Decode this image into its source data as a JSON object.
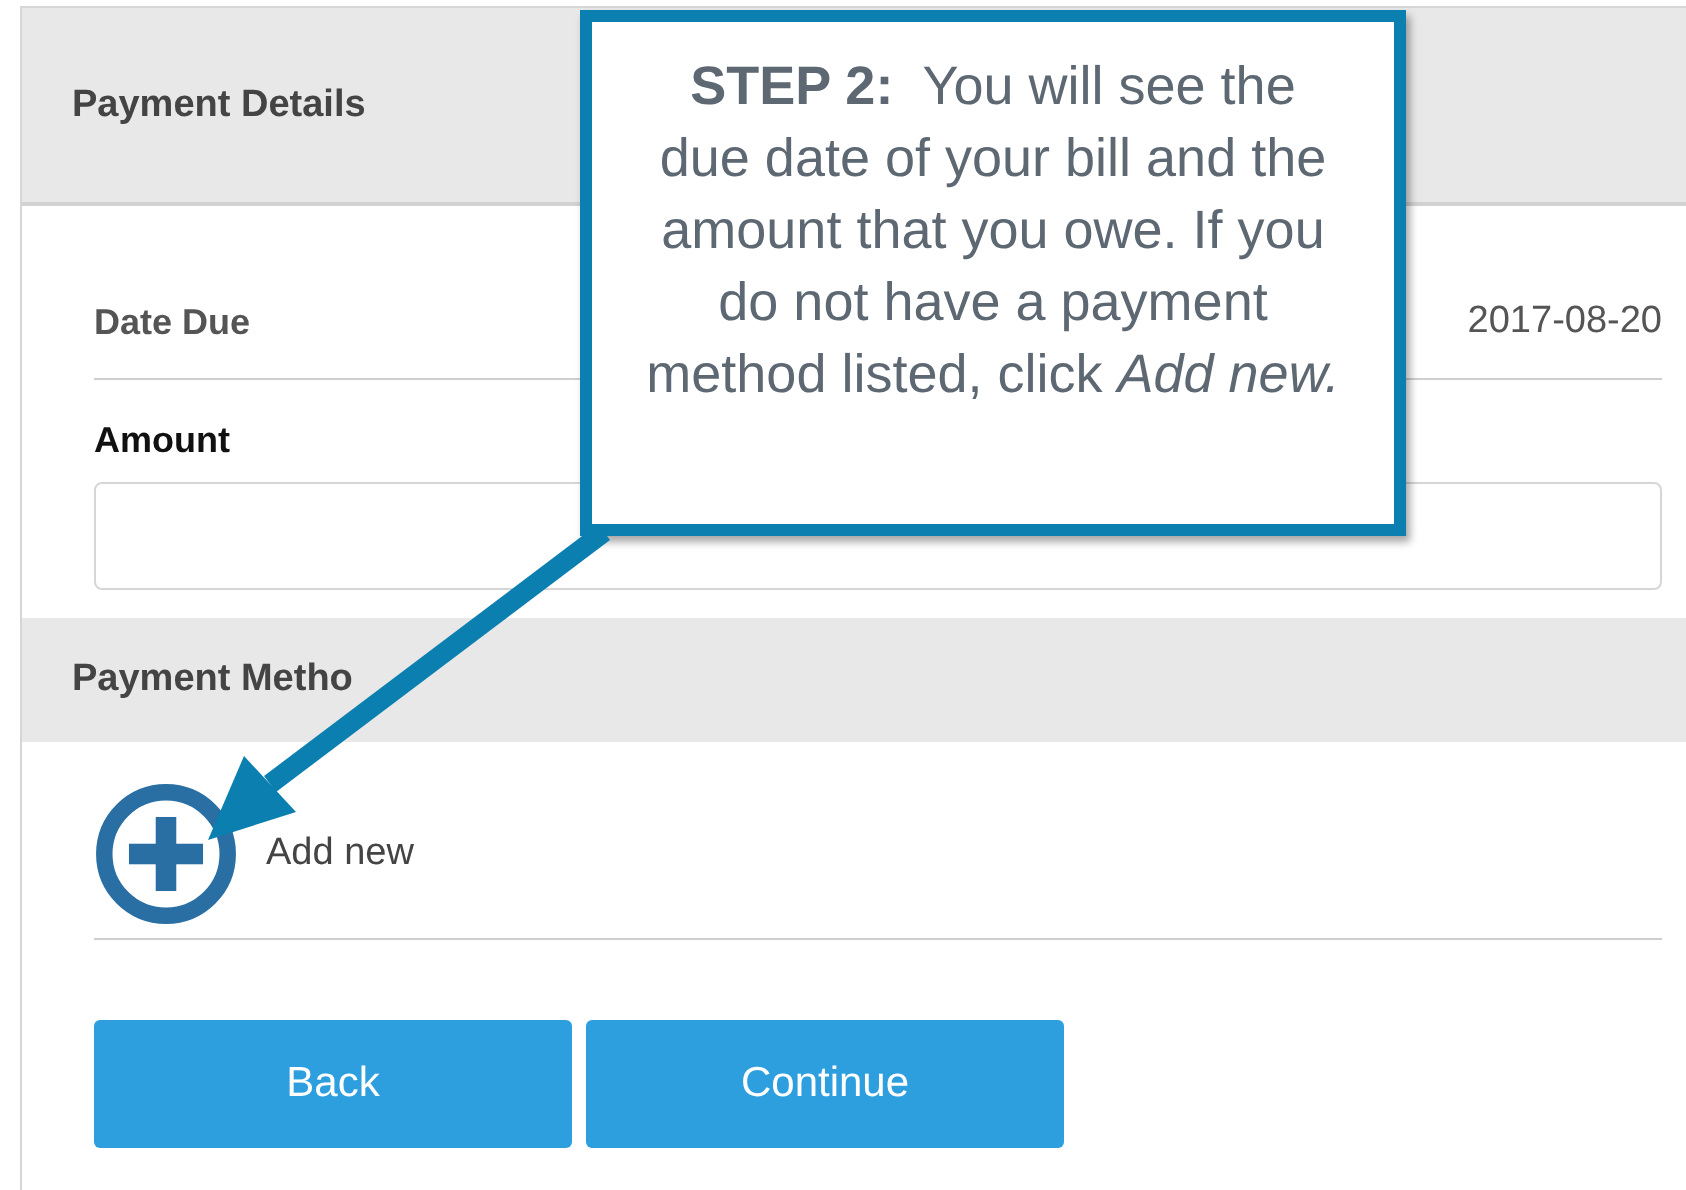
{
  "payment_details": {
    "title": "Payment Details",
    "date_due": {
      "label": "Date Due",
      "value": "2017-08-20"
    },
    "amount": {
      "label": "Amount"
    }
  },
  "payment_method": {
    "title": "Payment Metho",
    "add_new": "Add new"
  },
  "buttons": [
    "Back",
    "Continue"
  ],
  "callout": {
    "text": "**STEP 2:**  You will see the due date of your bill and the amount that you owe. If you do not have a payment method listed, click *Add new.*"
  }
}
